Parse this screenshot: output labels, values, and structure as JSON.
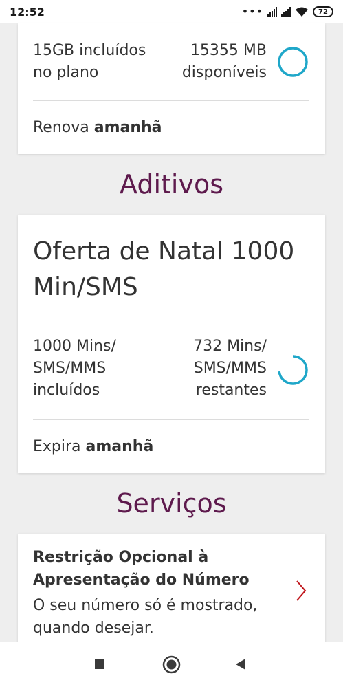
{
  "status_bar": {
    "time": "12:52",
    "battery": "72",
    "icons": [
      "more-dots-icon",
      "signal-icon",
      "signal-icon",
      "wifi-icon",
      "battery-icon"
    ]
  },
  "plan": {
    "included": "15GB incluídos\nno plano",
    "available": "15355 MB\ndisponíveis",
    "available_fraction": 1.0,
    "renew_prefix": "Renova ",
    "renew_when": "amanhã"
  },
  "addons": {
    "section_title": "Aditivos",
    "offer_title": "Oferta de Natal 1000\nMin/SMS",
    "included": "1000 Mins/\nSMS/MMS\nincluídos",
    "remaining": "732 Mins/\nSMS/MMS\nrestantes",
    "remaining_fraction": 0.732,
    "expire_prefix": "Expira ",
    "expire_when": "amanhã"
  },
  "services": {
    "section_title": "Serviços",
    "item_title": "Restrição Opcional à\nApresentação do Número",
    "item_desc": "O seu número só é mostrado,\nquando desejar."
  },
  "colors": {
    "accent_purple": "#5e1a4d",
    "ring_blue": "#1fa7c9",
    "chevron_red": "#c0151b"
  }
}
